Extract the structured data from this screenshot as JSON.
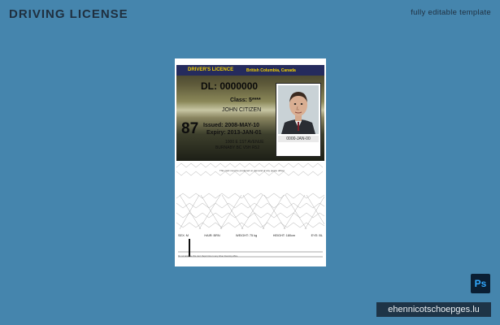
{
  "page": {
    "title": "DRIVING LICENSE",
    "subtitle": "fully editable template",
    "watermark": "ehennicotschoepges.lu",
    "ps_badge": "Ps"
  },
  "license": {
    "header_title": "DRIVER'S LICENCE",
    "province": "British Columbia, Canada",
    "dl_number": "DL:  0000000",
    "class_line": "Class:  5****",
    "holder_name": "JOHN CITIZEN",
    "age_number": "87",
    "issued_line": "Issued: 2008-MAY-10",
    "expiry_line": "Expiry:  2013-JAN-01",
    "address_line1": "1000 E 1ST AVENUE",
    "address_line2": "BURNABY BC  V5H R52",
    "photo_caption": "0000-JAN-00"
  },
  "back": {
    "disclaimer": "This card must be produced on demand of any peace officer",
    "stats": [
      "SEX:  M",
      "HAIR: BRN",
      "WEIGHT: 75 kg",
      "HEIGHT: 180cm",
      "EYE: BL"
    ],
    "fine_print": "Do not laminate this card. Report loss to any driver licensing office."
  },
  "colors": {
    "background": "#4585ad",
    "header_bar": "#252b5d",
    "header_text": "#f2d000",
    "ps_badge_bg": "#0a1e33",
    "ps_badge_fg": "#31a8ff"
  }
}
